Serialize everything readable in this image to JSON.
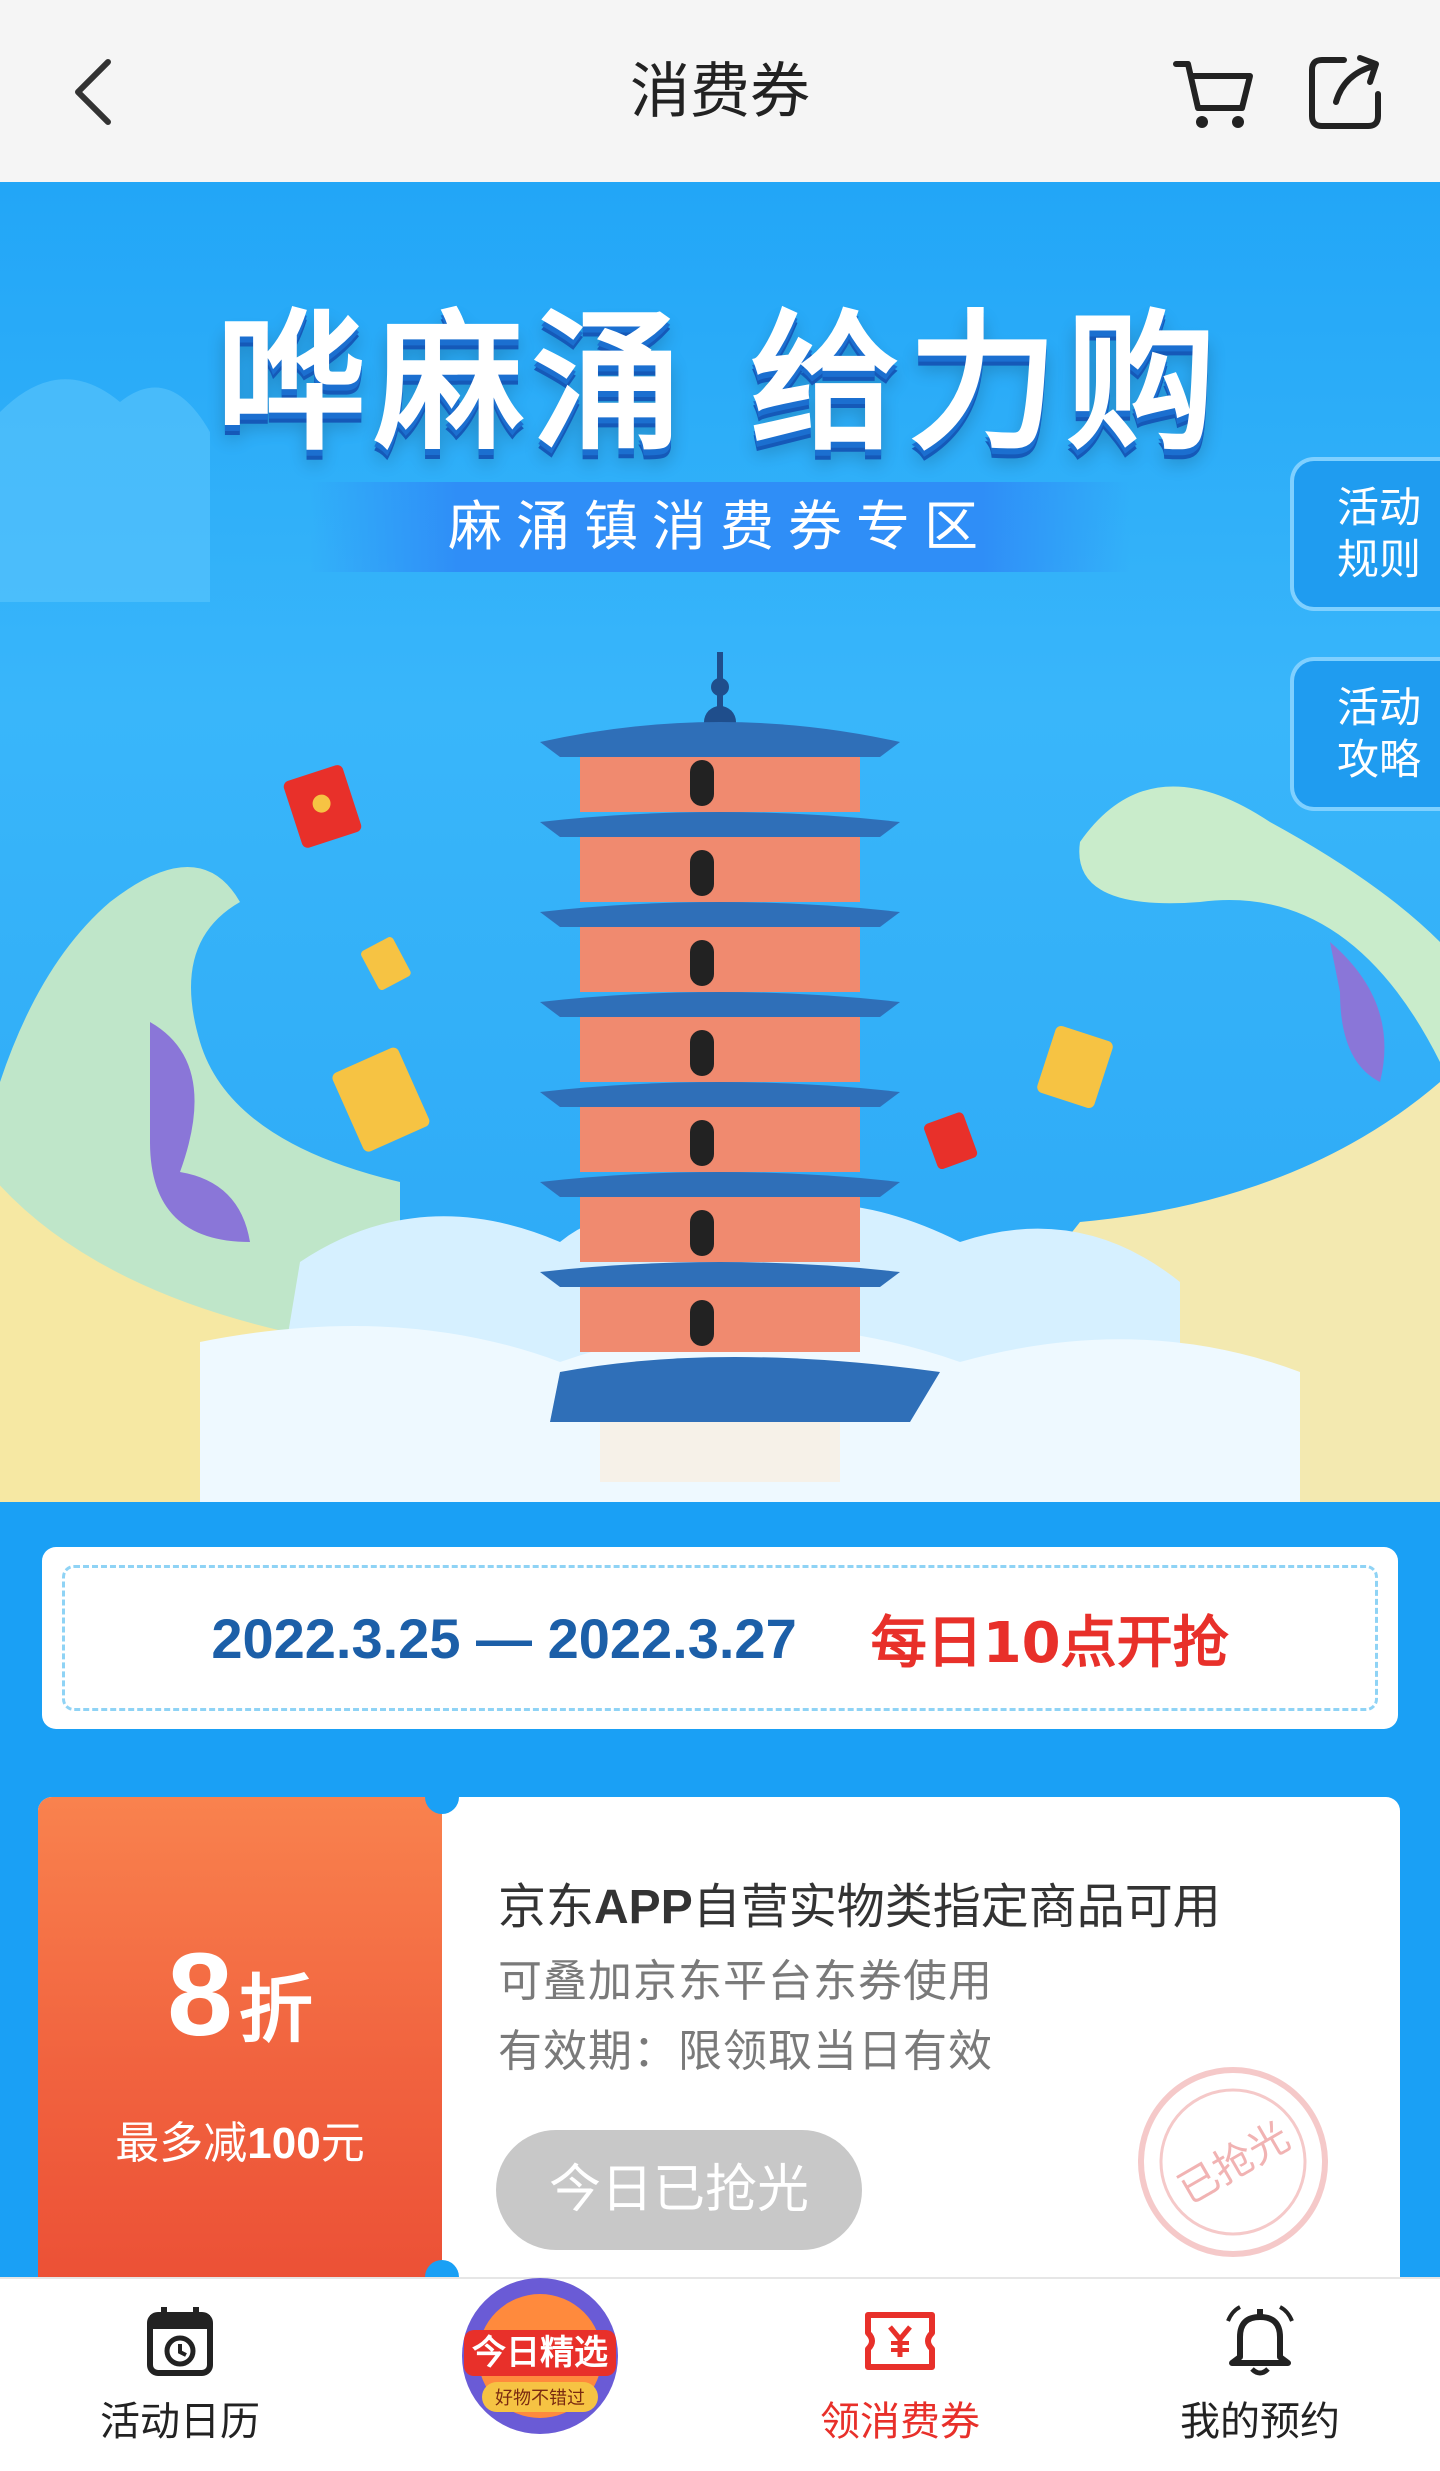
{
  "header": {
    "title": "消费券",
    "back_icon": "chevron-left-icon",
    "cart_icon": "cart-icon",
    "share_icon": "share-icon"
  },
  "banner": {
    "title": "哗麻涌 给力购",
    "subtitle": "麻涌镇消费券专区",
    "side_tabs": [
      {
        "line1": "活动",
        "line2": "规则"
      },
      {
        "line1": "活动",
        "line2": "攻略"
      }
    ]
  },
  "event": {
    "date_range": "2022.3.25 — 2022.3.27",
    "note": "每日10点开抢"
  },
  "coupon": {
    "discount_value": "8",
    "discount_unit": "折",
    "max_off_prefix": "最多减",
    "max_off_amount": "100",
    "max_off_suffix": "元",
    "title_prefix": "京东",
    "title_bold": "APP",
    "title_suffix": "自营实物类指定商品可用",
    "line1": "可叠加京东平台东券使用",
    "line2": "有效期：限领取当日有效",
    "button_label": "今日已抢光",
    "stamp_text": "已抢光"
  },
  "bottom_nav": {
    "calendar": {
      "label": "活动日历",
      "icon": "calendar-icon"
    },
    "promo": {
      "line1": "今日精选",
      "line2": "好物不错过"
    },
    "coupons": {
      "label": "领消费券",
      "icon": "coupon-yen-icon"
    },
    "booking": {
      "label": "我的预约",
      "icon": "bell-icon"
    }
  },
  "colors": {
    "accent_red": "#e8302a",
    "banner_blue": "#22a6f7",
    "coupon_orange": "#f1633f",
    "date_blue": "#1c5fa8"
  }
}
